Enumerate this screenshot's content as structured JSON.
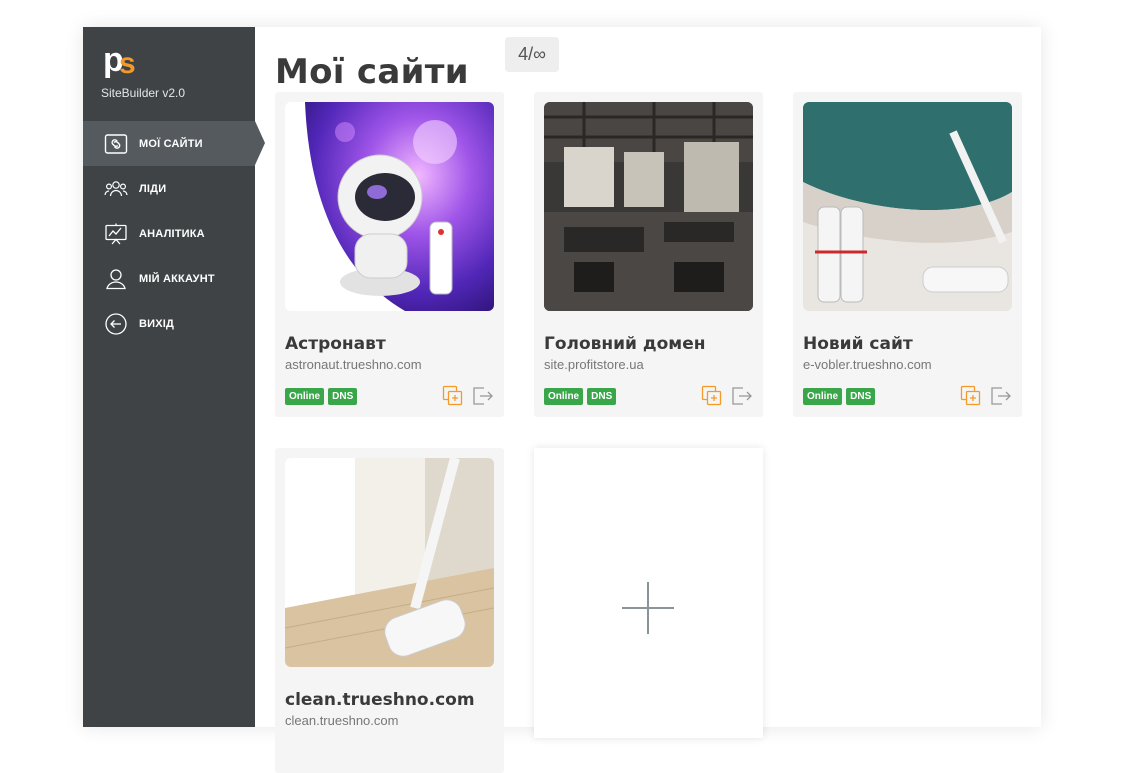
{
  "brand": {
    "logo_p": "p",
    "logo_s": "s",
    "name": "SiteBuilder v2.0"
  },
  "nav": [
    {
      "label": "МОЇ САЙТИ",
      "icon": "sites-icon",
      "active": true
    },
    {
      "label": "ЛІДИ",
      "icon": "leads-icon",
      "active": false
    },
    {
      "label": "АНАЛІТИКА",
      "icon": "analytics-icon",
      "active": false
    },
    {
      "label": "МІЙ АККАУНТ",
      "icon": "account-icon",
      "active": false
    },
    {
      "label": "ВИХІД",
      "icon": "logout-icon",
      "active": false
    }
  ],
  "header": {
    "title": "Мої сайти",
    "counter": "4/∞"
  },
  "sites": [
    {
      "name": "Астронавт",
      "domain": "astronaut.trueshno.com",
      "badges": [
        "Online",
        "DNS"
      ],
      "image": "astronaut-projector"
    },
    {
      "name": "Головний домен",
      "domain": "site.profitstore.ua",
      "badges": [
        "Online",
        "DNS"
      ],
      "image": "office-interior"
    },
    {
      "name": "Новий сайт",
      "domain": "e-vobler.trueshno.com",
      "badges": [
        "Online",
        "DNS"
      ],
      "image": "lint-roller-pillow"
    },
    {
      "name": "clean.trueshno.com",
      "domain": "clean.trueshno.com",
      "badges": [],
      "image": "floor-roller"
    }
  ],
  "add_site": {
    "icon": "plus-icon"
  },
  "colors": {
    "sidebar": "#3f4346",
    "active": "#545a5e",
    "accent": "#f39a28",
    "badge": "#3aa64a"
  }
}
